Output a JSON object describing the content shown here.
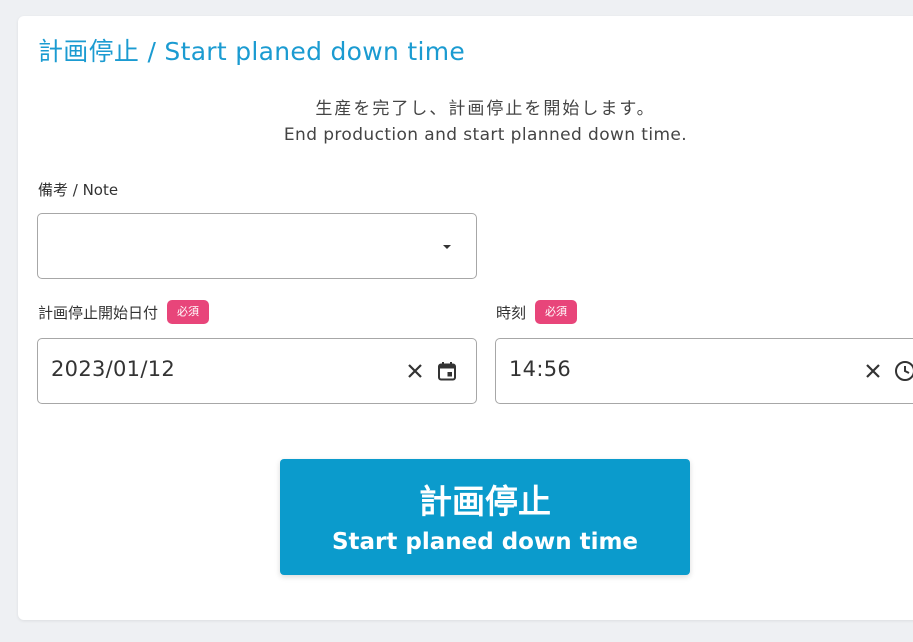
{
  "dialog": {
    "title": "計画停止 / Start planed down time",
    "description_ja": "生産を完了し、計画停止を開始します。",
    "description_en": "End production and start planned down time."
  },
  "note": {
    "label": "備考 / Note",
    "value": "",
    "icons": [
      "dropdown-arrow-icon"
    ]
  },
  "start_date": {
    "label": "計画停止開始日付",
    "required_badge": "必須",
    "value": "2023/01/12",
    "icons": [
      "clear-icon",
      "calendar-icon"
    ]
  },
  "time": {
    "label": "時刻",
    "required_badge": "必須",
    "value": "14:56",
    "icons": [
      "clear-icon",
      "clock-icon"
    ]
  },
  "submit": {
    "label_ja": "計画停止",
    "label_en": "Start planed down time"
  },
  "colors": {
    "accent": "#1b9bd1",
    "button": "#0b9bcc",
    "badge": "#e8457a",
    "background": "#eef0f3"
  }
}
